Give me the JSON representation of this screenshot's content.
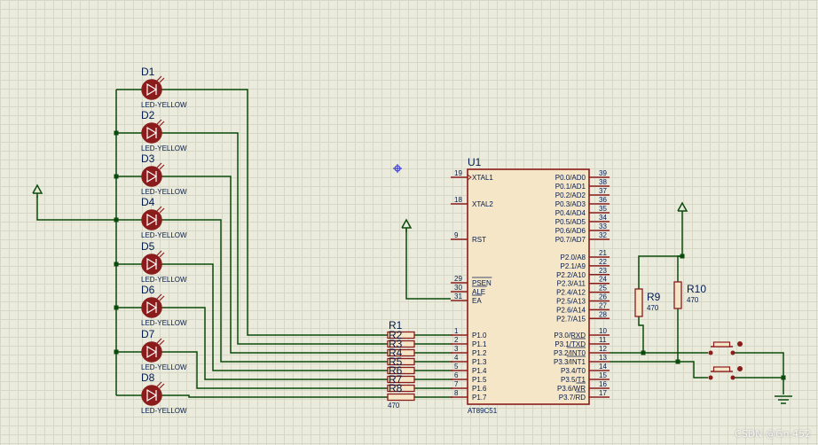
{
  "leds": [
    {
      "ref": "D1",
      "value": "LED-YELLOW"
    },
    {
      "ref": "D2",
      "value": "LED-YELLOW"
    },
    {
      "ref": "D3",
      "value": "LED-YELLOW"
    },
    {
      "ref": "D4",
      "value": "LED-YELLOW"
    },
    {
      "ref": "D5",
      "value": "LED-YELLOW"
    },
    {
      "ref": "D6",
      "value": "LED-YELLOW"
    },
    {
      "ref": "D7",
      "value": "LED-YELLOW"
    },
    {
      "ref": "D8",
      "value": "LED-YELLOW"
    }
  ],
  "rpack": {
    "ref": "R1",
    "value": "470",
    "labels": [
      "R2",
      "R3",
      "R4",
      "R5",
      "R6",
      "R7",
      "R8"
    ]
  },
  "mcu": {
    "ref": "U1",
    "part": "AT89C51",
    "left_pins": [
      {
        "num": "19",
        "name": "XTAL1",
        "clock": true
      },
      {
        "num": "18",
        "name": "XTAL2"
      },
      {
        "num": "9",
        "name": "RST"
      },
      {
        "num": "29",
        "name": "PSEN",
        "bar": true
      },
      {
        "num": "30",
        "name": "ALE",
        "bar": true
      },
      {
        "num": "31",
        "name": "EA",
        "bar": true
      },
      {
        "num": "1",
        "name": "P1.0"
      },
      {
        "num": "2",
        "name": "P1.1"
      },
      {
        "num": "3",
        "name": "P1.2"
      },
      {
        "num": "4",
        "name": "P1.3"
      },
      {
        "num": "5",
        "name": "P1.4"
      },
      {
        "num": "6",
        "name": "P1.5"
      },
      {
        "num": "7",
        "name": "P1.6"
      },
      {
        "num": "8",
        "name": "P1.7"
      }
    ],
    "right_pins": [
      {
        "num": "39",
        "name": "P0.0/AD0"
      },
      {
        "num": "38",
        "name": "P0.1/AD1"
      },
      {
        "num": "37",
        "name": "P0.2/AD2"
      },
      {
        "num": "36",
        "name": "P0.3/AD3"
      },
      {
        "num": "35",
        "name": "P0.4/AD4"
      },
      {
        "num": "34",
        "name": "P0.5/AD5"
      },
      {
        "num": "33",
        "name": "P0.6/AD6"
      },
      {
        "num": "32",
        "name": "P0.7/AD7"
      },
      {
        "num": "21",
        "name": "P2.0/A8"
      },
      {
        "num": "22",
        "name": "P2.1/A9"
      },
      {
        "num": "23",
        "name": "P2.2/A10"
      },
      {
        "num": "24",
        "name": "P2.3/A11"
      },
      {
        "num": "25",
        "name": "P2.4/A12"
      },
      {
        "num": "26",
        "name": "P2.5/A13"
      },
      {
        "num": "27",
        "name": "P2.6/A14"
      },
      {
        "num": "28",
        "name": "P2.7/A15"
      },
      {
        "num": "10",
        "name": "P3.0/RXD"
      },
      {
        "num": "11",
        "name": "P3.1/TXD",
        "bar_tail": "TXD"
      },
      {
        "num": "12",
        "name": "P3.2/INT0",
        "bar_tail": "INT0"
      },
      {
        "num": "13",
        "name": "P3.3/INT1",
        "bar_tail": "INT1"
      },
      {
        "num": "14",
        "name": "P3.4/T0"
      },
      {
        "num": "15",
        "name": "P3.5/T1"
      },
      {
        "num": "16",
        "name": "P3.6/WR",
        "bar_tail": "WR"
      },
      {
        "num": "17",
        "name": "P3.7/RD",
        "bar_tail": "RD"
      }
    ]
  },
  "resistors": [
    {
      "ref": "R9",
      "value": "470"
    },
    {
      "ref": "R10",
      "value": "470"
    }
  ],
  "watermark": "CSDN @Gn.452",
  "colors": {
    "background": "#ebebdd",
    "grid": "#d6d6c4",
    "component": "#8b1c1c",
    "body_fill": "#f5e6c8",
    "wire": "#0a4a0a",
    "label": "#001a4d",
    "junction": "#0a4a0a"
  }
}
